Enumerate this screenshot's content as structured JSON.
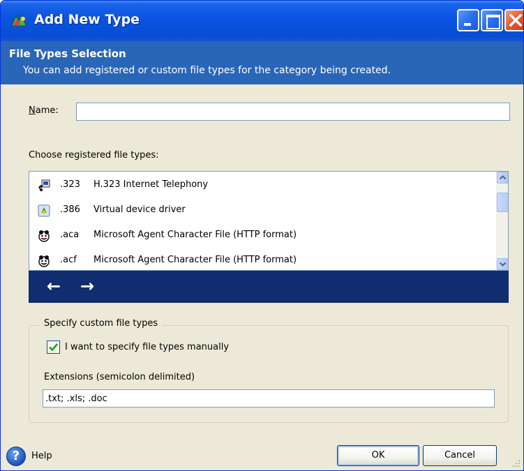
{
  "window": {
    "title": "Add New Type"
  },
  "header": {
    "title": "File Types Selection",
    "subtitle": "You can add registered or custom file types for the category being created."
  },
  "name_field": {
    "label": "Name:",
    "value": ""
  },
  "registered": {
    "label": "Choose registered file types:",
    "items": [
      {
        "ext": ".323",
        "description": "H.323 Internet Telephony",
        "icon": "telephony-icon"
      },
      {
        "ext": ".386",
        "description": "Virtual device driver",
        "icon": "driver-icon"
      },
      {
        "ext": ".aca",
        "description": "Microsoft Agent Character File (HTTP format)",
        "icon": "agent-character-icon"
      },
      {
        "ext": ".acf",
        "description": "Microsoft Agent Character File (HTTP format)",
        "icon": "agent-character-icon"
      }
    ],
    "nav_back": "←",
    "nav_forward": "→"
  },
  "custom": {
    "legend": "Specify custom file types",
    "checkbox_label": "I want to specify file types manually",
    "checkbox_checked": true,
    "extensions_label": "Extensions (semicolon delimited)",
    "extensions_value": ".txt; .xls; .doc"
  },
  "footer": {
    "help_label": "Help",
    "ok_label": "OK",
    "cancel_label": "Cancel"
  },
  "colors": {
    "title_bar": "#0a54e2",
    "header_band": "#2a66b8",
    "nav_bar": "#0f2d6f",
    "dialog_bg": "#ece9d8"
  }
}
